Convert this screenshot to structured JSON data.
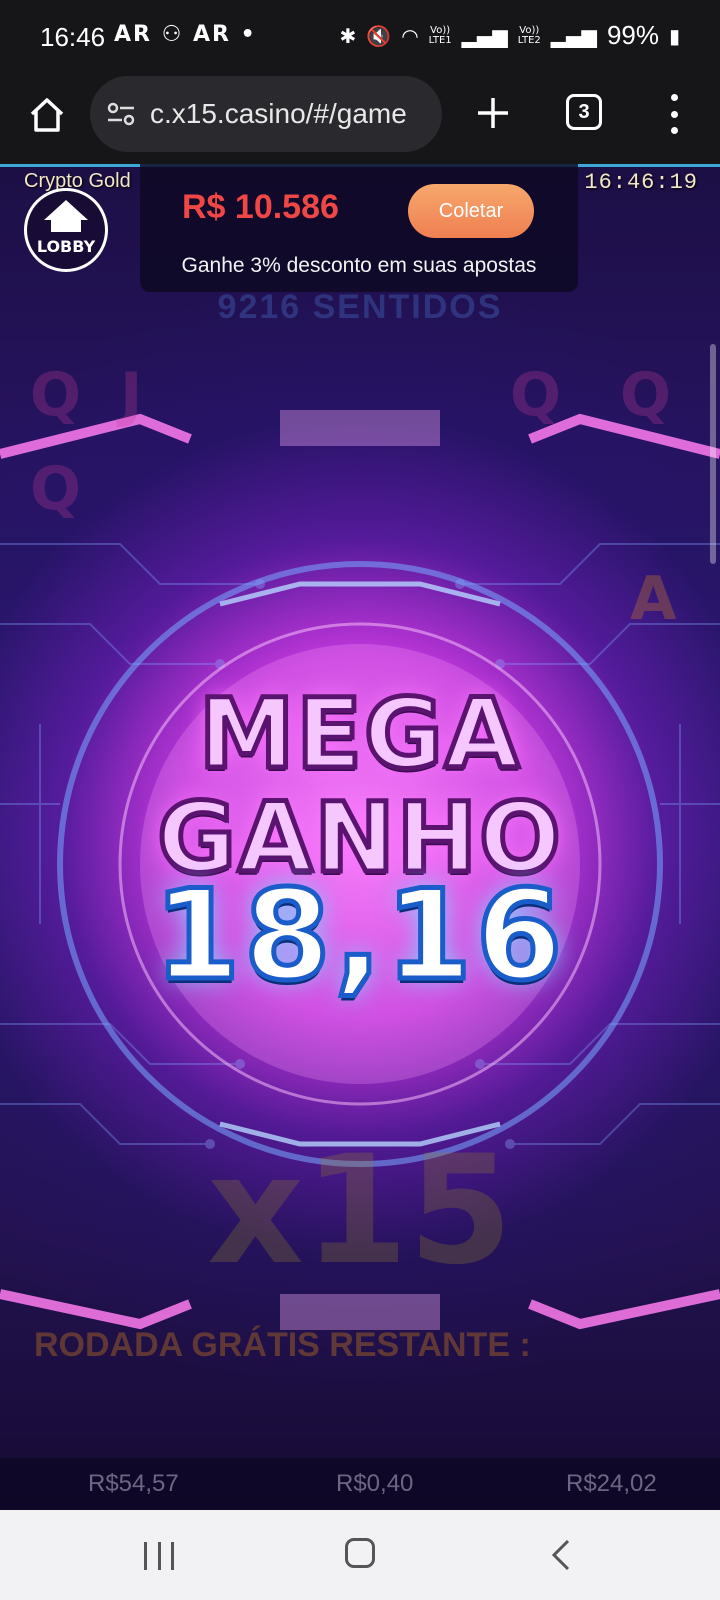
{
  "status_bar": {
    "time": "16:46",
    "left_icons": "AR ⚇ AR •",
    "sim1_top": "Vo))",
    "sim1_bottom": "LTE1",
    "sim2_top": "Vo))",
    "sim2_bottom": "LTE2",
    "battery": "99%"
  },
  "browser": {
    "url": "c.x15.casino/#/game",
    "tab_count": "3",
    "icons": [
      "home-icon",
      "site-info-icon",
      "new-tab-icon",
      "tab-switcher-icon",
      "more-menu-icon"
    ]
  },
  "game": {
    "title": "Crypto Gold",
    "clock": "16:46:19",
    "lobby_label": "LOBBY",
    "balance": "R$ 10.586",
    "collect_label": "Coletar",
    "promo_text": "Ganhe 3% desconto em suas apostas",
    "ways_text": "9216 SENTIDOS",
    "win_title_line1": "MEGA",
    "win_title_line2": "GANHO",
    "win_amount": "18,16",
    "logo_faded": "x15",
    "free_spins_label": "RODADA GRÁTIS RESTANTE :",
    "bottom_values": [
      "R$54,57",
      "R$0,40",
      "R$24,02"
    ],
    "colors": {
      "balance": "#ef4646",
      "collect_button": "#ef8a5a",
      "mega_text": "#f6c6ff",
      "win_amount_outline": "#1a5cc9"
    }
  },
  "nav_bar": {
    "icons": [
      "recent-apps-icon",
      "home-icon",
      "back-icon"
    ]
  }
}
